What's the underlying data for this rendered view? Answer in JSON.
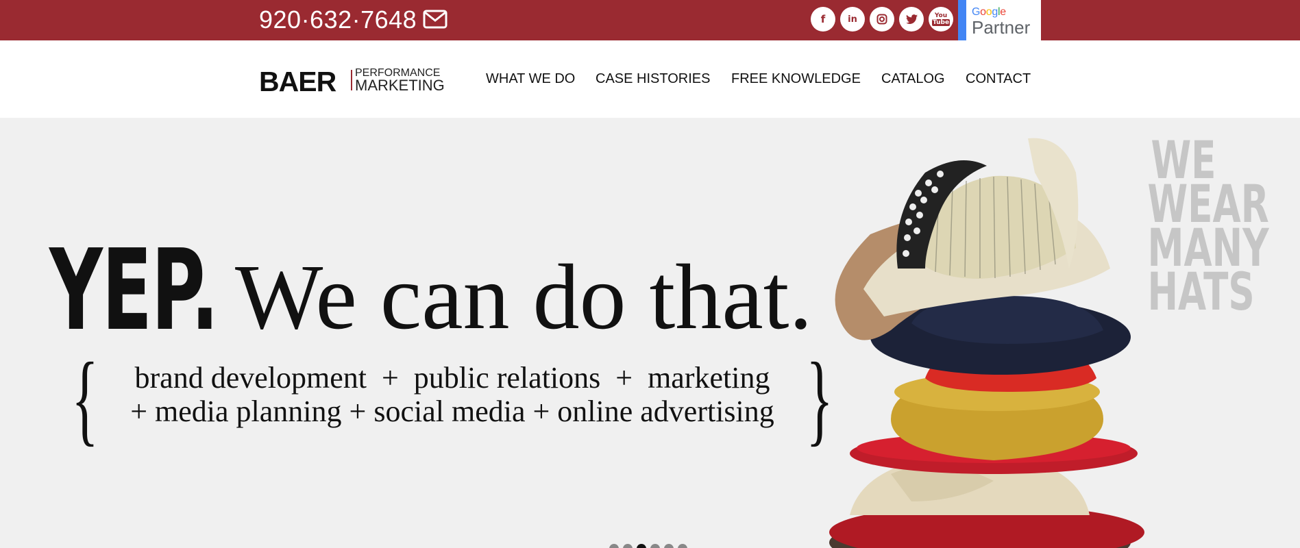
{
  "topbar": {
    "phone": "920·632·7648",
    "social_icons": [
      "facebook-icon",
      "linkedin-icon",
      "instagram-icon",
      "twitter-icon",
      "youtube-icon"
    ],
    "google_partner": {
      "google": "Google",
      "partner": "Partner"
    }
  },
  "logo": {
    "main": "BAER",
    "line1": "PERFORMANCE",
    "line2": "MARKETING"
  },
  "nav": {
    "items": [
      {
        "label": "WHAT WE DO"
      },
      {
        "label": "CASE HISTORIES"
      },
      {
        "label": "FREE KNOWLEDGE"
      },
      {
        "label": "CATALOG"
      },
      {
        "label": "CONTACT"
      }
    ]
  },
  "hero": {
    "yep": "YEP.",
    "tagline": "We can do that.",
    "services_line1": "brand development  +  public relations  +  marketing",
    "services_line2": "+ media planning + social media + online advertising",
    "brace_open": "{",
    "brace_close": "}",
    "hats_lines": [
      "WE",
      "WEAR",
      "MANY",
      "HATS"
    ]
  },
  "slider": {
    "total": 6,
    "active": 3
  },
  "colors": {
    "brand_red": "#9a2a31",
    "google_blue": "#4285f4"
  }
}
